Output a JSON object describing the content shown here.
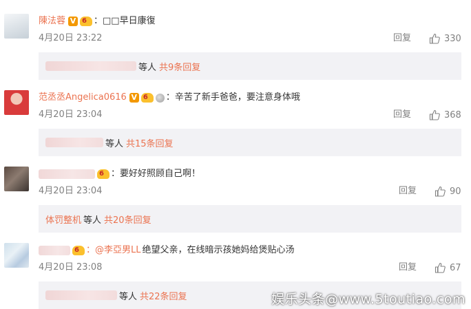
{
  "comments": [
    {
      "username": "陳法蓉",
      "has_v": true,
      "vip_level": "6",
      "text": "：□□早日康復",
      "time": "4月20日 23:22",
      "reply_label": "回复",
      "like_count": "330",
      "sub": {
        "deng": "等人",
        "total": "共9条回复"
      }
    },
    {
      "username": "范丞丞Angelica0616",
      "has_v": true,
      "vip_level": "6",
      "text": "：辛苦了新手爸爸，要注意身体哦",
      "time": "4月20日 23:04",
      "reply_label": "回复",
      "like_count": "368",
      "sub": {
        "deng": "等人",
        "total": "共15条回复"
      }
    },
    {
      "username": "",
      "vip_level": "6",
      "text": "：要好好照顾自己啊！",
      "time": "4月20日 23:04",
      "reply_label": "回复",
      "like_count": "90",
      "sub": {
        "who": "体罚整机",
        "deng": "等人",
        "total": "共20条回复"
      }
    },
    {
      "username": "",
      "vip_level": "6",
      "mention": "：@李亞男LL",
      "text": " 绝望父亲，在线暗示孩她妈给煲贴心汤",
      "time": "4月20日 23:08",
      "reply_label": "回复",
      "like_count": "67",
      "sub": {
        "deng": "等人",
        "total": "共22条回复"
      }
    }
  ],
  "watermark": "娱乐头条@www.5toutiao.com",
  "colors": {
    "accent": "#eb7350",
    "muted": "#808080",
    "box": "#f2f2f5"
  }
}
